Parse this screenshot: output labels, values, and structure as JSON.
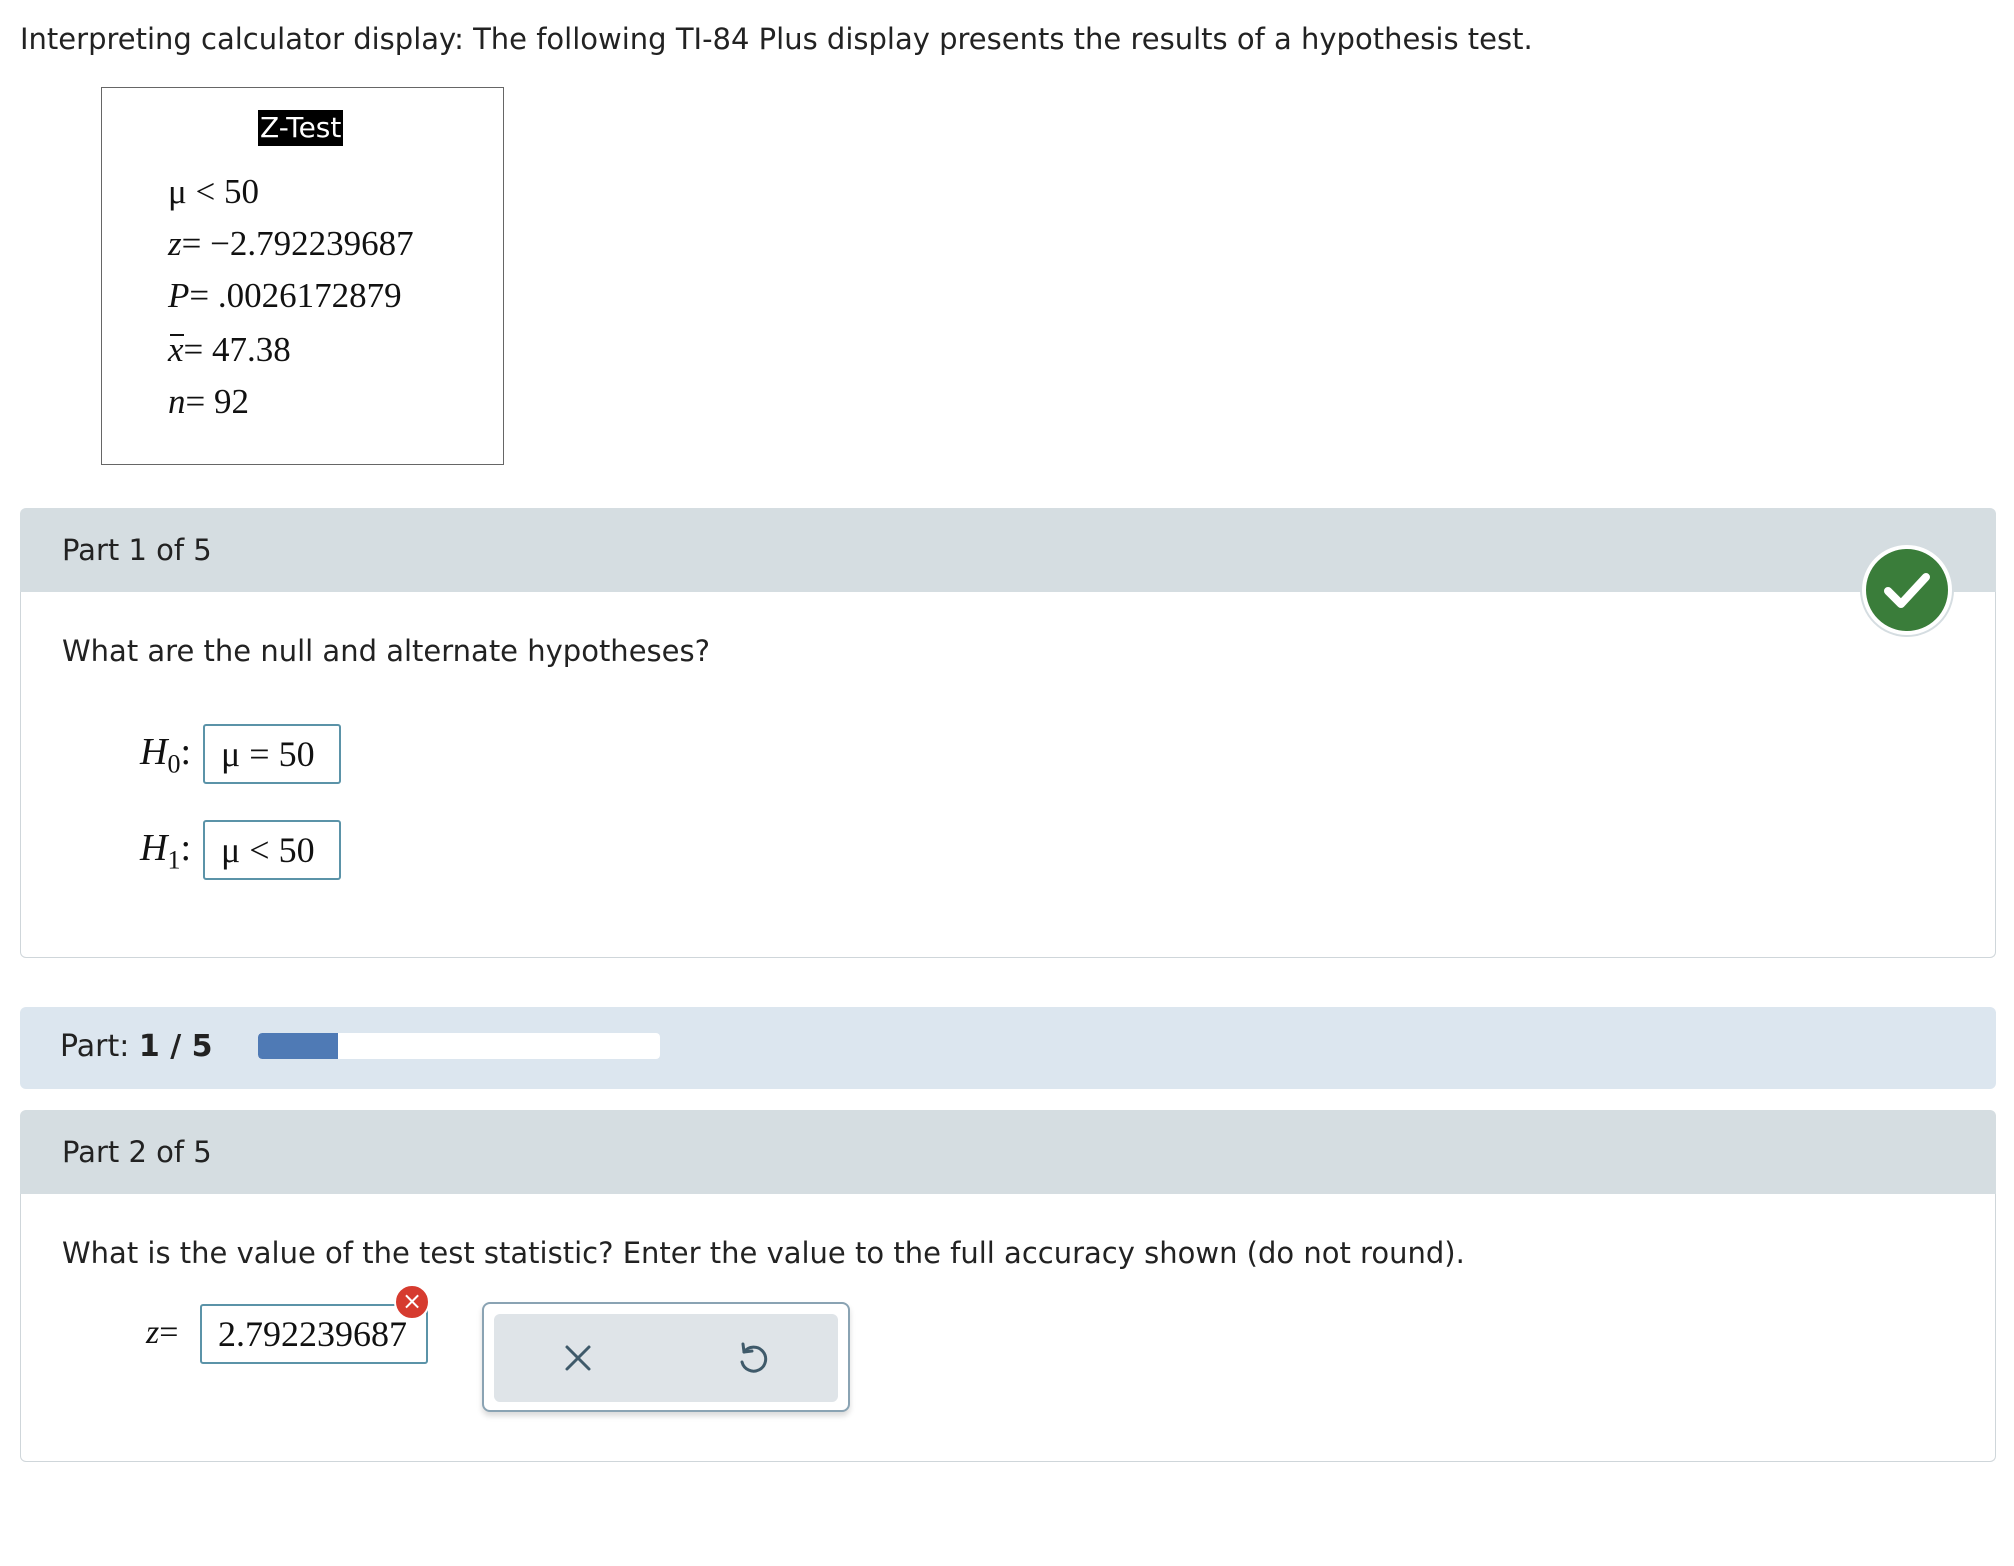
{
  "intro": "Interpreting calculator display: The following TI-84 Plus display presents the results of a hypothesis test.",
  "calculator": {
    "title": "Z-Test",
    "hypothesis": "μ < 50",
    "z_label": "z",
    "z_value": "= −2.792239687",
    "p_label": "P",
    "p_value": "= .0026172879",
    "xbar_label": "x",
    "xbar_value": "= 47.38",
    "n_label": "n",
    "n_value": "= 92"
  },
  "part1": {
    "header": "Part 1 of 5",
    "status_icon": "check-icon",
    "status_color": "#3a7d3a",
    "question": "What are the null and alternate hypotheses?",
    "h0_label": "H",
    "h0_sub": "0",
    "h0_answer": "μ = 50",
    "h1_label": "H",
    "h1_sub": "1",
    "h1_answer": "μ < 50",
    "colon": ":"
  },
  "progress": {
    "label": "Part:",
    "value": "1 / 5",
    "fraction": 0.2,
    "fill_color": "#4f7ab5"
  },
  "part2": {
    "header": "Part 2 of 5",
    "question": "What is the value of the test statistic? Enter the value to the full accuracy shown (do not round).",
    "z_label": "z",
    "equals": "=",
    "answer": "2.792239687",
    "error_icon": "×",
    "error_color": "#d63b2f"
  },
  "toolbar": {
    "clear_icon": "close-icon",
    "undo_icon": "undo-icon"
  }
}
